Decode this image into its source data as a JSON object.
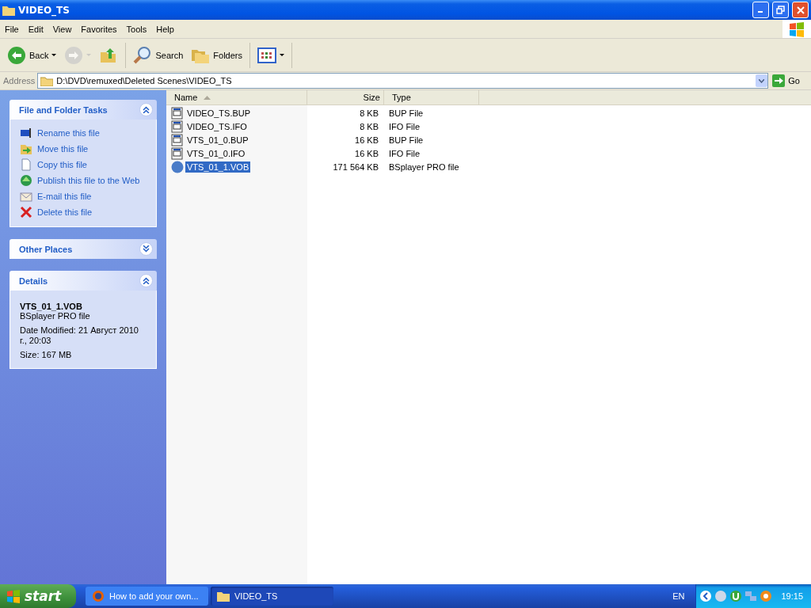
{
  "window": {
    "title": "VIDEO_TS"
  },
  "menu": [
    "File",
    "Edit",
    "View",
    "Favorites",
    "Tools",
    "Help"
  ],
  "toolbar": {
    "groups": [
      [
        {
          "kind": "back",
          "label": "Back",
          "dropdown": true,
          "disabled": false
        },
        {
          "kind": "forward",
          "dropdown": true,
          "disabled": true
        },
        {
          "kind": "up",
          "dropdown": false,
          "disabled": false
        }
      ],
      [
        {
          "kind": "search",
          "label": "Search",
          "dropdown": false,
          "disabled": false
        },
        {
          "kind": "folders",
          "label": "Folders",
          "dropdown": false,
          "disabled": false
        }
      ],
      [
        {
          "kind": "views",
          "dropdown": true,
          "disabled": false
        }
      ]
    ]
  },
  "address": {
    "label": "Address",
    "value": "D:\\DVD\\remuxed\\Deleted Scenes\\VIDEO_TS",
    "go": "Go"
  },
  "sidebar": {
    "panels": [
      {
        "kind": "tasks",
        "title": "File and Folder Tasks",
        "expanded": true,
        "items": [
          {
            "kind": "rename",
            "label": "Rename this file"
          },
          {
            "kind": "move",
            "label": "Move this file"
          },
          {
            "kind": "copy",
            "label": "Copy this file"
          },
          {
            "kind": "publish",
            "label": "Publish this file to the Web"
          },
          {
            "kind": "email",
            "label": "E-mail this file"
          },
          {
            "kind": "delete",
            "label": "Delete this file"
          }
        ]
      },
      {
        "kind": "tasks",
        "title": "Other Places",
        "expanded": false
      },
      {
        "kind": "details",
        "title": "Details",
        "expanded": true,
        "name": "VTS_01_1.VOB",
        "type": "BSplayer PRO file",
        "modified": "Date Modified: 21 Август 2010 г., 20:03",
        "size": "Size: 167 MB"
      }
    ]
  },
  "table": {
    "columns": [
      {
        "label": "Name",
        "sorted": true
      },
      {
        "label": "Size",
        "sorted": false
      },
      {
        "label": "Type",
        "sorted": false
      }
    ],
    "rows": [
      {
        "kind": "doc",
        "name": "VIDEO_TS.BUP",
        "size": "8 KB",
        "type": "BUP File",
        "selected": false
      },
      {
        "kind": "doc",
        "name": "VIDEO_TS.IFO",
        "size": "8 KB",
        "type": "IFO File",
        "selected": false
      },
      {
        "kind": "doc",
        "name": "VTS_01_0.BUP",
        "size": "16 KB",
        "type": "BUP File",
        "selected": false
      },
      {
        "kind": "doc",
        "name": "VTS_01_0.IFO",
        "size": "16 KB",
        "type": "IFO File",
        "selected": false
      },
      {
        "kind": "media",
        "name": "VTS_01_1.VOB",
        "size": "171 564 KB",
        "type": "BSplayer PRO file",
        "selected": true
      }
    ]
  },
  "taskbar": {
    "start": "start",
    "tasks": [
      {
        "kind": "browser",
        "label": "How to add your own...",
        "selected": false
      },
      {
        "kind": "folder",
        "label": "VIDEO_TS",
        "selected": true
      }
    ],
    "language": "EN",
    "clock": "19:15"
  }
}
